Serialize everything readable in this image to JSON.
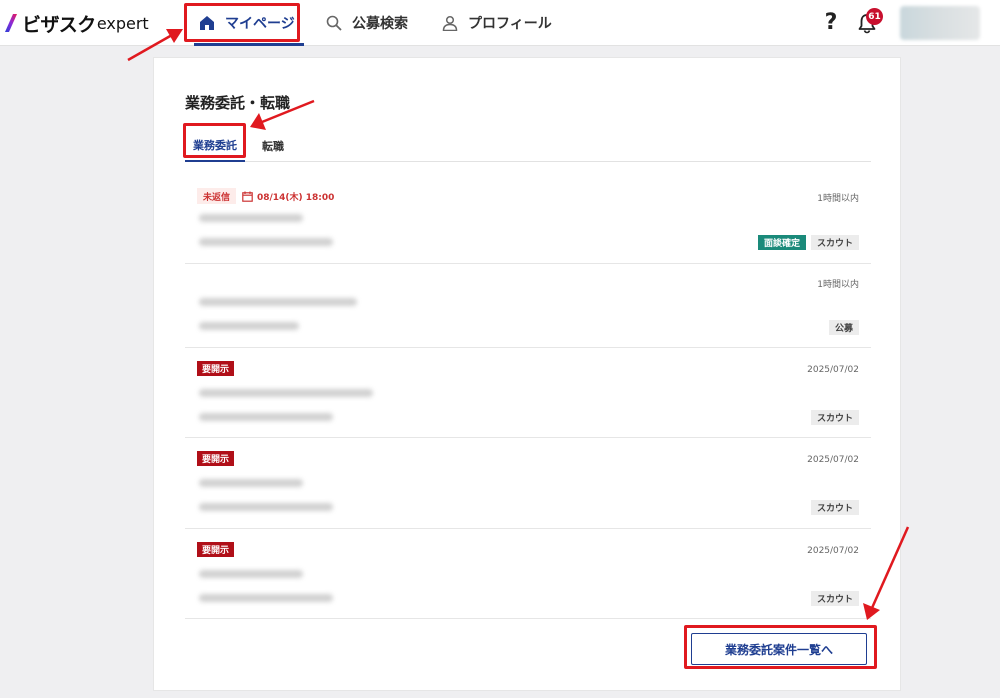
{
  "header": {
    "logo_main": "ビザスク",
    "logo_sub": "expert",
    "nav": [
      {
        "label": "マイページ",
        "icon": "home-icon"
      },
      {
        "label": "公募検索",
        "icon": "search-icon"
      },
      {
        "label": "プロフィール",
        "icon": "user-icon"
      }
    ],
    "help_label": "?",
    "notification_count": "61"
  },
  "page": {
    "title": "業務委託・転職",
    "tabs": [
      {
        "label": "業務委託",
        "active": true
      },
      {
        "label": "転職",
        "active": false
      }
    ],
    "items": [
      {
        "status": "未返信",
        "deadline": "08/14(木) 18:00",
        "date": "1時間以内",
        "badges": [
          "面談確定",
          "スカウト"
        ]
      },
      {
        "status": "",
        "deadline": "",
        "date": "1時間以内",
        "badges": [
          "公募"
        ]
      },
      {
        "status": "要開示",
        "deadline": "",
        "date": "2025/07/02",
        "badges": [
          "スカウト"
        ]
      },
      {
        "status": "要開示",
        "deadline": "",
        "date": "2025/07/02",
        "badges": [
          "スカウト"
        ]
      },
      {
        "status": "要開示",
        "deadline": "",
        "date": "2025/07/02",
        "badges": [
          "スカウト"
        ]
      }
    ],
    "cta_label": "業務委託案件一覧へ"
  },
  "colors": {
    "brand_blue": "#1f3e91",
    "alert_red": "#b00f18",
    "annotation_red": "#e0191f",
    "confirm_green": "#1a8a7a"
  }
}
